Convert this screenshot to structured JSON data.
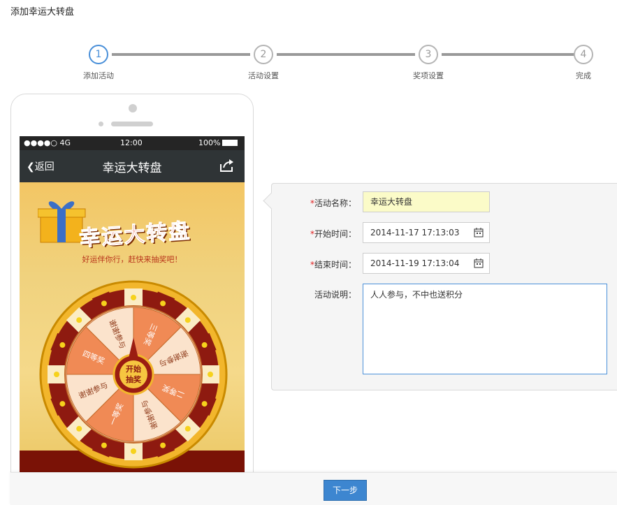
{
  "page": {
    "title": "添加幸运大转盘"
  },
  "steps": [
    {
      "num": "1",
      "label": "添加活动",
      "active": true
    },
    {
      "num": "2",
      "label": "活动设置",
      "active": false
    },
    {
      "num": "3",
      "label": "奖项设置",
      "active": false
    },
    {
      "num": "4",
      "label": "完成",
      "active": false
    }
  ],
  "phone": {
    "status": {
      "signal": "●●●●○ 4G",
      "time": "12:00",
      "battery": "100%"
    },
    "nav": {
      "back": "返回",
      "title": "幸运大转盘"
    },
    "banner": {
      "logo_text": "幸运大转盘",
      "slogan": "好运伴你行，赶快来抽奖吧！"
    },
    "wheel": {
      "center_label": "开始\n抽奖",
      "segments": [
        "三等奖",
        "谢谢参与",
        "二等奖",
        "谢谢参与",
        "一等奖",
        "谢谢参与",
        "四等奖",
        "谢谢参与"
      ]
    }
  },
  "form": {
    "name": {
      "label": "活动名称：",
      "value": "幸运大转盘"
    },
    "start": {
      "label": "开始时间：",
      "value": "2014-11-17 17:13:03"
    },
    "end": {
      "label": "结束时间：",
      "value": "2014-11-19 17:13:04"
    },
    "desc": {
      "label": "活动说明：",
      "value": "人人参与，不中也送积分"
    }
  },
  "footer": {
    "next_label": "下一步"
  },
  "colors": {
    "accent": "#3d86d0",
    "required": "#e02020",
    "step_active": "#4a90d9"
  }
}
